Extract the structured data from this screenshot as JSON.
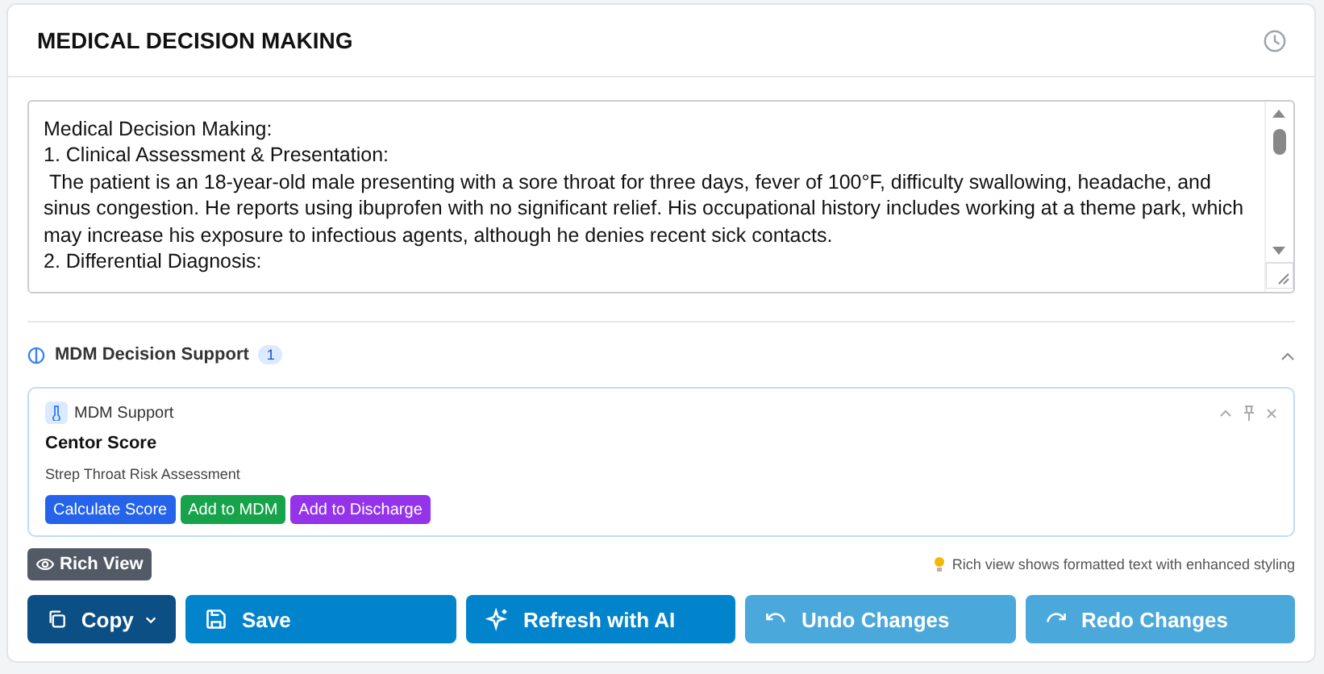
{
  "header": {
    "title": "MEDICAL DECISION MAKING"
  },
  "note": {
    "lines": [
      "Medical Decision Making:",
      "1. Clinical Assessment & Presentation:",
      " The patient is an 18-year-old male presenting with a sore throat for three days, fever of 100°F, difficulty swallowing, headache, and sinus congestion. He reports using ibuprofen with no significant relief. His occupational history includes working at a theme park, which may increase his exposure to infectious agents, although he denies recent sick contacts.",
      "2. Differential Diagnosis:"
    ]
  },
  "support": {
    "title": "MDM Decision Support",
    "count": "1",
    "expanded": true,
    "card": {
      "source": "MDM Support",
      "title": "Centor Score",
      "subtitle": "Strep Throat Risk Assessment",
      "actions": [
        {
          "label": "Calculate Score",
          "color": "#2563eb"
        },
        {
          "label": "Add to MDM",
          "color": "#16a34a"
        },
        {
          "label": "Add to Discharge",
          "color": "#9333ea"
        }
      ]
    }
  },
  "view_toggle": {
    "label": "Rich View",
    "hint": "Rich view shows formatted text with enhanced styling"
  },
  "buttons": [
    {
      "kind": "copy",
      "label": "Copy",
      "disabled": false
    },
    {
      "kind": "save",
      "label": "Save",
      "disabled": false
    },
    {
      "kind": "refresh",
      "label": "Refresh with AI",
      "disabled": false
    },
    {
      "kind": "undo",
      "label": "Undo Changes",
      "disabled": true
    },
    {
      "kind": "redo",
      "label": "Redo Changes",
      "disabled": true
    }
  ]
}
